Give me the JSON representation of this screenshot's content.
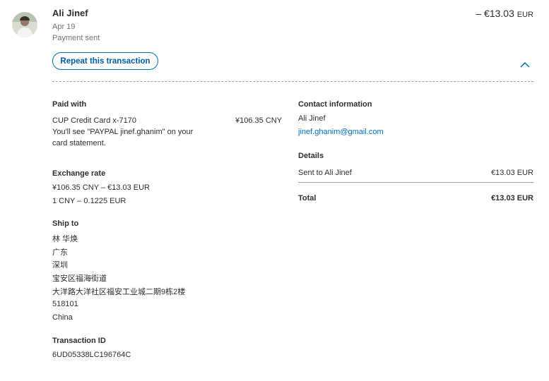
{
  "header": {
    "name": "Ali Jinef",
    "date": "Apr 19",
    "status": "Payment sent",
    "amount": "– €13.03",
    "currency": "EUR",
    "repeat_button": "Repeat this transaction"
  },
  "paid_with": {
    "label": "Paid with",
    "card": "CUP Credit Card x-7170",
    "amount": "¥106.35 CNY",
    "statement_line1": "You'll see \"PAYPAL  jinef.ghanim\" on your",
    "statement_line2": "card statement."
  },
  "exchange": {
    "label": "Exchange rate",
    "line1": "¥106.35 CNY – €13.03 EUR",
    "line2": "1 CNY – 0.1225 EUR"
  },
  "ship_to": {
    "label": "Ship to",
    "lines": [
      "林 华焕",
      "广东",
      "深圳",
      "宝安区福海街道",
      "大洋路大洋社区福安工业城二期9栋2楼",
      "518101",
      "China"
    ]
  },
  "transaction": {
    "label": "Transaction ID",
    "id": "6UD05338LC196764C"
  },
  "contact": {
    "label": "Contact information",
    "name": "Ali Jinef",
    "email": "jinef.ghanim@gmail.com"
  },
  "details": {
    "label": "Details",
    "row_label": "Sent to Ali Jinef",
    "row_amount": "€13.03 EUR",
    "total_label": "Total",
    "total_amount": "€13.03 EUR"
  },
  "colors": {
    "link": "#0070ba",
    "muted": "#6c7378"
  }
}
